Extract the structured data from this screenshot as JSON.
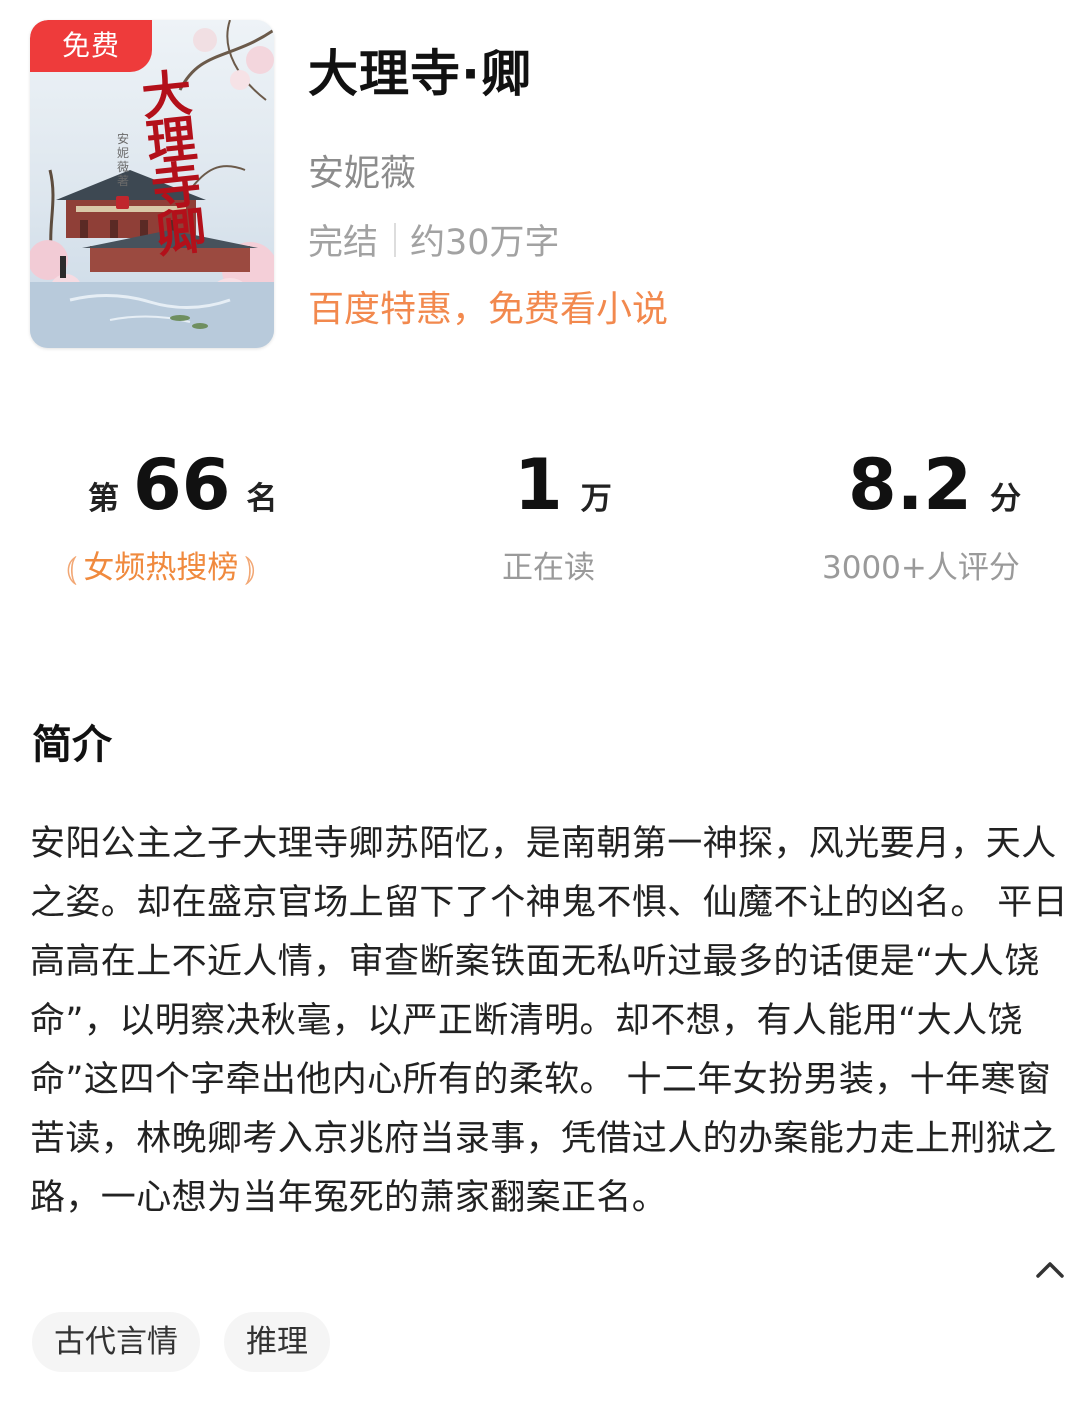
{
  "book": {
    "free_badge": "免费",
    "cover_title": "大理寺卿",
    "cover_author": "安妮薇著",
    "title": "大理寺·卿",
    "author": "安妮薇",
    "status": "完结",
    "word_count": "约30万字",
    "promo": "百度特惠，免费看小说"
  },
  "stats": {
    "rank": {
      "prefix": "第",
      "value": "66",
      "suffix": "名",
      "label": "女频热搜榜",
      "laurel_left": "⦅",
      "laurel_right": "⦆"
    },
    "readers": {
      "value": "1",
      "unit": "万",
      "label": "正在读"
    },
    "score": {
      "value": "8.2",
      "unit": "分",
      "label": "3000+人评分"
    }
  },
  "intro": {
    "heading": "简介",
    "text": "安阳公主之子大理寺卿苏陌忆，是南朝第一神探，风光要月，天人之姿。却在盛京官场上留下了个神鬼不惧、仙魔不让的凶名。 平日高高在上不近人情，审查断案铁面无私听过最多的话便是“大人饶命”，以明察决秋毫，以严正断清明。却不想，有人能用“大人饶命”这四个字牵出他内心所有的柔软。 十二年女扮男装，十年寒窗苦读，林晚卿考入京兆府当录事，凭借过人的办案能力走上刑狱之路，一心想为当年冤死的萧家翻案正名。"
  },
  "tags": [
    "古代言情",
    "推理"
  ],
  "colors": {
    "badge_red": "#ee3b3b",
    "promo_orange": "#f2894e",
    "rank_orange": "#f08a3e",
    "muted_grey": "#9a9a9a"
  },
  "icons": {
    "collapse": "chevron-up-icon"
  }
}
